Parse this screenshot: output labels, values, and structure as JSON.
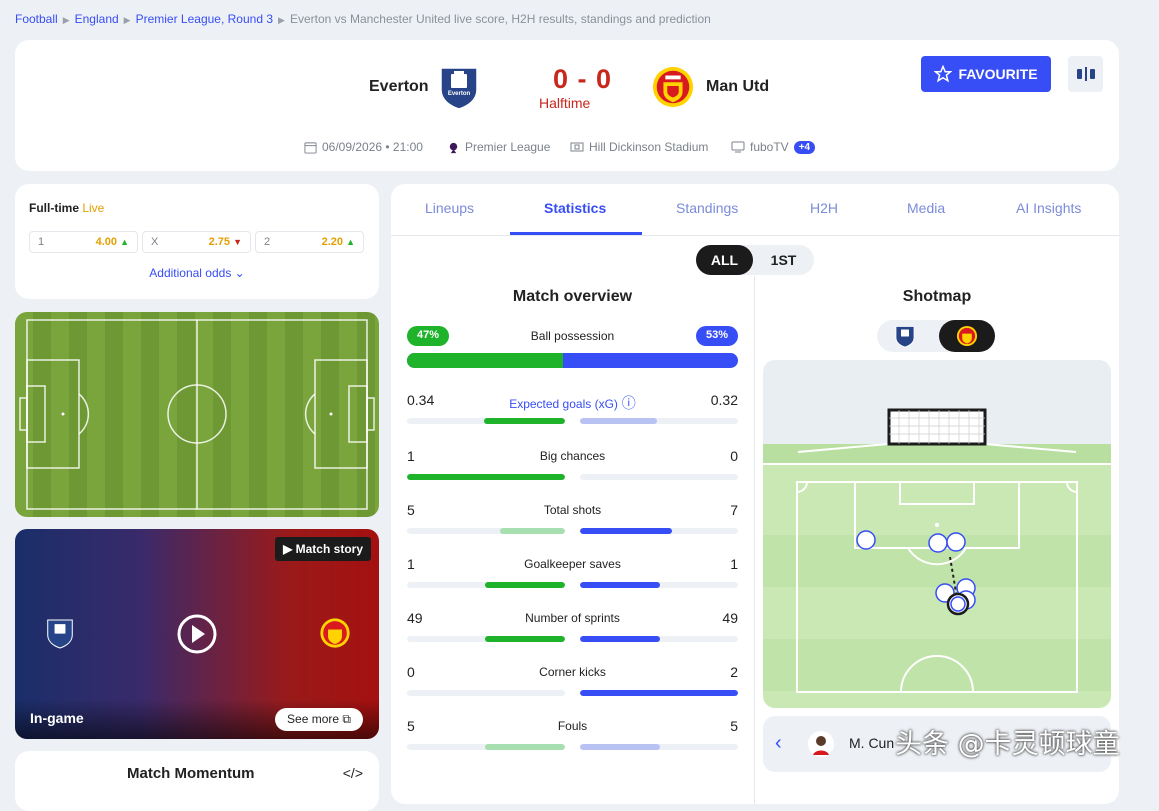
{
  "breadcrumbs": {
    "items": [
      "Football",
      "England",
      "Premier League, Round 3"
    ],
    "current": "Everton vs Manchester United live score, H2H results, standings and prediction"
  },
  "match": {
    "home_team": "Everton",
    "away_team": "Man Utd",
    "score": "0 - 0",
    "status": "Halftime",
    "date_time": "06/09/2026 • 21:00",
    "competition": "Premier League",
    "venue": "Hill Dickinson Stadium",
    "broadcaster": "fuboTV",
    "more_broadcasters": "+4",
    "favourite_label": "FAVOURITE",
    "home_color": "#274488",
    "away_color": "#d81920",
    "accent": "#374df5"
  },
  "odds": {
    "title": "Full-time",
    "live_label": "Live",
    "items": [
      {
        "key": "1",
        "value": "4.00",
        "trend": "up"
      },
      {
        "key": "X",
        "value": "2.75",
        "trend": "down"
      },
      {
        "key": "2",
        "value": "2.20",
        "trend": "up"
      }
    ],
    "additional_label": "Additional odds"
  },
  "video": {
    "story_label": "Match story",
    "ingame_label": "In-game",
    "see_more_label": "See more"
  },
  "momentum": {
    "title": "Match Momentum"
  },
  "tabs": {
    "items": [
      "Lineups",
      "Statistics",
      "Standings",
      "H2H",
      "Media",
      "AI Insights"
    ],
    "active": "Statistics"
  },
  "period": {
    "all": "ALL",
    "first": "1ST"
  },
  "overview": {
    "title": "Match overview",
    "possession": {
      "label": "Ball possession",
      "home": "47%",
      "away": "53%",
      "home_fraction": 0.47
    },
    "stats": [
      {
        "label": "Expected goals (xG)",
        "home": "0.34",
        "away": "0.32",
        "home_share": 0.515,
        "away_share": 0.485,
        "link": true
      },
      {
        "label": "Big chances",
        "home": "1",
        "away": "0",
        "home_share": 1,
        "away_share": 0
      },
      {
        "label": "Total shots",
        "home": "5",
        "away": "7",
        "home_share": 0.42,
        "away_share": 0.58
      },
      {
        "label": "Goalkeeper saves",
        "home": "1",
        "away": "1",
        "home_share": 0.5,
        "away_share": 0.5
      },
      {
        "label": "Number of sprints",
        "home": "49",
        "away": "49",
        "home_share": 0.5,
        "away_share": 0.5
      },
      {
        "label": "Corner kicks",
        "home": "0",
        "away": "2",
        "home_share": 0,
        "away_share": 1
      },
      {
        "label": "Fouls",
        "home": "5",
        "away": "5",
        "home_share": 0.5,
        "away_share": 0.5
      }
    ]
  },
  "shotmap": {
    "title": "Shotmap",
    "player_name": "M. Cun"
  },
  "watermark": "头条 @卡灵顿球童"
}
